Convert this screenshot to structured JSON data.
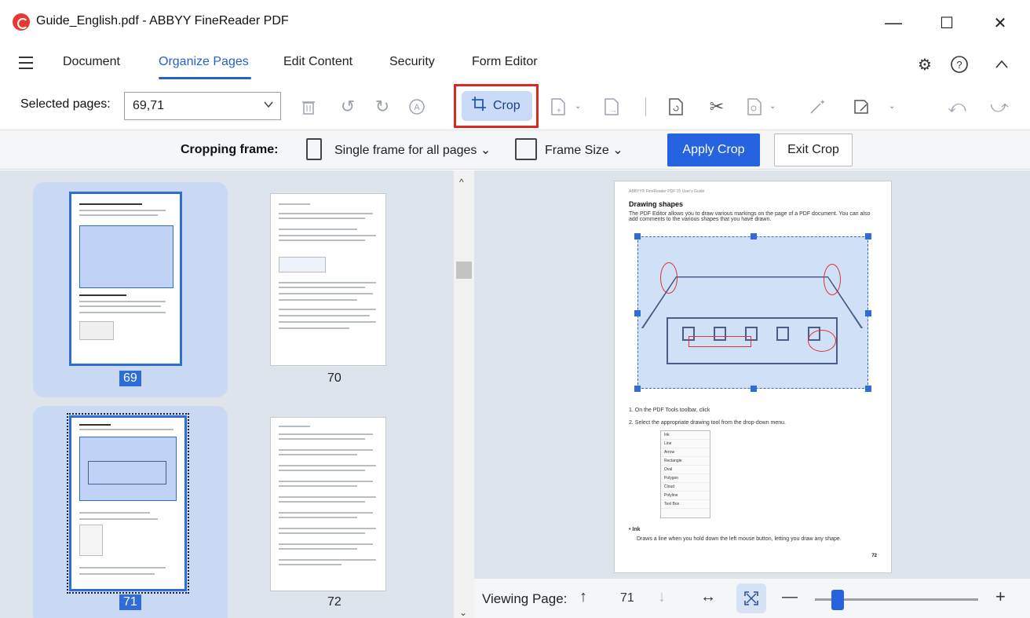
{
  "window": {
    "title": "Guide_English.pdf - ABBYY FineReader PDF",
    "minimize": "—",
    "maximize": "☐",
    "close": "✕"
  },
  "menu": {
    "items": [
      "Document",
      "Organize Pages",
      "Edit Content",
      "Security",
      "Form Editor"
    ],
    "active_index": 1
  },
  "toolbar": {
    "selected_pages_label": "Selected pages:",
    "selected_pages_value": "69,71",
    "crop_label": "Crop"
  },
  "cropbar": {
    "label": "Cropping frame:",
    "frame_mode": "Single frame for all pages",
    "frame_size": "Frame Size",
    "apply": "Apply Crop",
    "exit": "Exit Crop"
  },
  "thumbnails": [
    {
      "page": "69",
      "selected": true
    },
    {
      "page": "70",
      "selected": false
    },
    {
      "page": "71",
      "selected": true
    },
    {
      "page": "72",
      "selected": false
    }
  ],
  "document_page": {
    "header": "ABBYY® FineReader PDF 15 User's Guide",
    "title": "Drawing shapes",
    "intro": "The PDF Editor allows you to draw various markings on the page of a PDF document. You can also add comments to the various shapes that you have drawn.",
    "step1": "1.  On the PDF Tools toolbar, click",
    "step2": "2.  Select the appropriate drawing tool from the drop-down menu.",
    "tools": [
      "Ink",
      "Line",
      "Arrow",
      "Rectangle",
      "Oval",
      "Polygon",
      "Cloud",
      "Polyline",
      "Text Box"
    ],
    "ink_heading": "•  Ink",
    "ink_text": "Draws a line when you hold down the left mouse button, letting you draw any shape.",
    "page_number": "72"
  },
  "status": {
    "viewing_label": "Viewing Page:",
    "current_page": "71",
    "zoom_fraction": 0.14
  },
  "colors": {
    "accent": "#2563e0",
    "crop_highlight": "#d92a2a",
    "selection": "#2f6cd8"
  }
}
